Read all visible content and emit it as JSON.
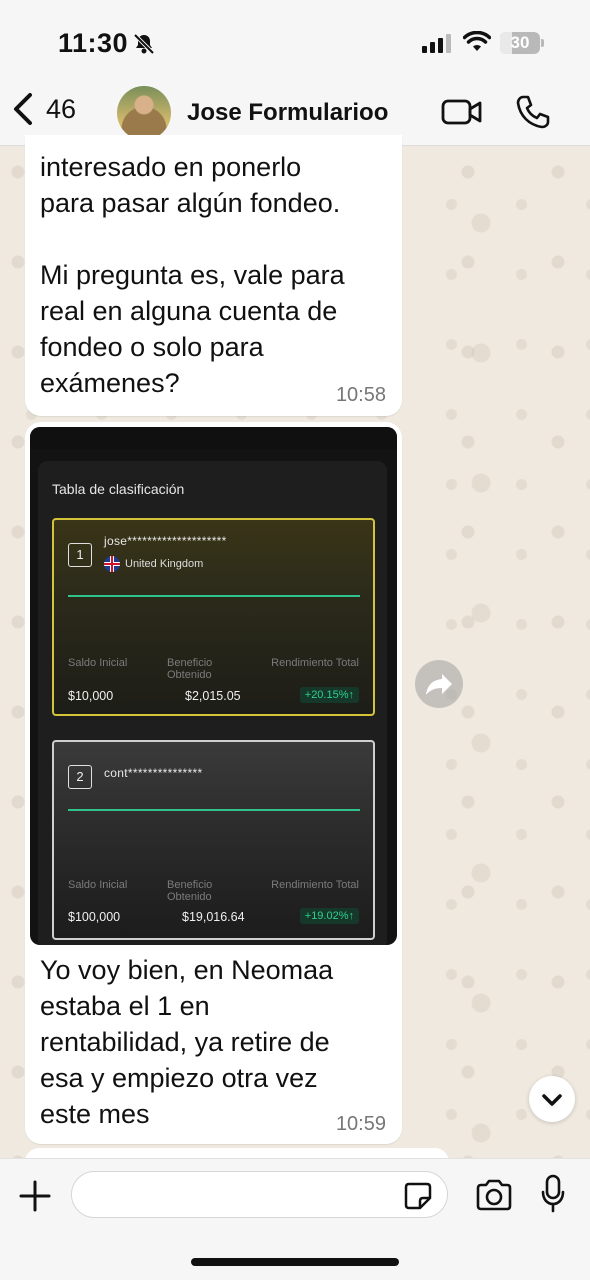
{
  "status_bar": {
    "time": "11:30",
    "battery": "30",
    "battery_level": 0.3
  },
  "header": {
    "back_count": "46",
    "contact_name": "Jose Formularioo"
  },
  "messages": [
    {
      "text": "interesado en ponerlo\npara pasar algún fondeo.\n\nMi pregunta es, vale para\nreal en alguna cuenta de\nfondeo o solo para\nexámenes?",
      "time": "10:58"
    },
    {
      "image": {
        "title": "Tabla de clasificación",
        "col_labels": {
          "initial": "Saldo Inicial",
          "profit": "Beneficio\nObtenido",
          "return": "Rendimiento Total"
        },
        "entries": [
          {
            "rank": "1",
            "user": "jose********************",
            "country": "United Kingdom",
            "initial": "$10,000",
            "profit": "$2,015.05",
            "return": "+20.15%↑"
          },
          {
            "rank": "2",
            "user": "cont***************",
            "initial": "$100,000",
            "profit": "$19,016.64",
            "return": "+19.02%↑"
          }
        ]
      },
      "text": "Yo voy bien, en Neomaa\nestaba el 1 en\nrentabilidad, ya retire de\nesa y empiezo otra vez\neste mes",
      "time": "10:59"
    }
  ],
  "icons": [
    "bell-slash-icon",
    "signal-icon",
    "wifi-icon",
    "battery-icon",
    "back-chevron-icon",
    "video-call-icon",
    "phone-call-icon",
    "forward-icon",
    "chevron-down-icon",
    "plus-icon",
    "sticker-icon",
    "camera-icon",
    "microphone-icon"
  ],
  "colors": {
    "bubble": "#ffffff",
    "accent_green": "#2fc28b",
    "card1_border": "#d4c43a"
  }
}
